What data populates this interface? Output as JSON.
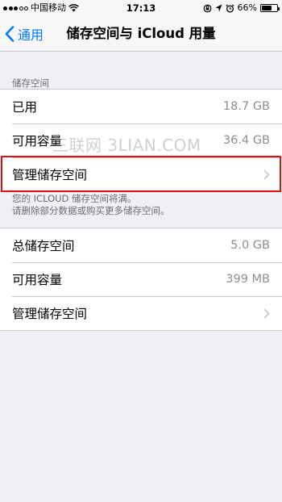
{
  "status_bar": {
    "carrier": "中国移动",
    "time": "17:13",
    "battery": "66%",
    "battery_level": 0.66,
    "icons": [
      "signal-dots-icon",
      "wifi-icon",
      "orientation-lock-icon",
      "location-icon",
      "alarm-icon",
      "battery-icon"
    ]
  },
  "nav": {
    "back_label": "通用",
    "title": "储存空间与 iCloud 用量"
  },
  "storage": {
    "header": "储存空间",
    "used_label": "已用",
    "used_value": "18.7 GB",
    "available_label": "可用容量",
    "available_value": "36.4 GB",
    "manage_label": "管理储存空间"
  },
  "icloud": {
    "footer_line1": "您的 ICLOUD 储存空间将满。",
    "footer_line2": "请删除部分数据或购买更多储存空间。",
    "total_label": "总储存空间",
    "total_value": "5.0 GB",
    "available_label": "可用容量",
    "available_value": "399 MB",
    "manage_label": "管理储存空间"
  },
  "watermark": "三联网 3LIAN.COM",
  "colors": {
    "accent": "#007aff",
    "highlight": "#e01010",
    "background": "#efeff4"
  }
}
